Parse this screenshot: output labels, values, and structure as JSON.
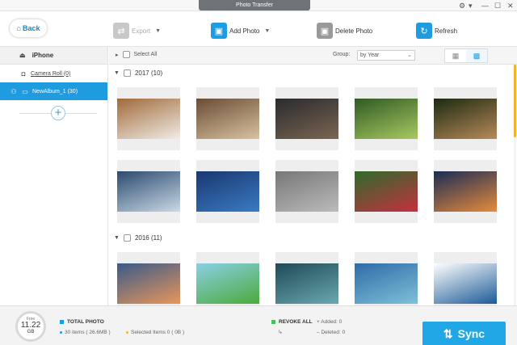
{
  "window": {
    "title": "Photo Transfer"
  },
  "toolbar": {
    "back_label": "Back",
    "export_label": "Export",
    "add_photo_label": "Add Photo",
    "delete_photo_label": "Delete Photo",
    "refresh_label": "Refresh"
  },
  "sidebar": {
    "device": "iPhone",
    "items": [
      {
        "label": "Camera Roll (0)",
        "icon": "camera-icon"
      },
      {
        "label": "NewAlbum_1 (30)",
        "icon": "album-icon",
        "active": true
      }
    ]
  },
  "controls": {
    "select_all": "Select All",
    "group_label": "Group:",
    "group_value": "by Year"
  },
  "sections": [
    {
      "label": "2017 (10)"
    },
    {
      "label": "2016 (11)"
    }
  ],
  "photos_2017": [
    {
      "icon": "kitten-photo",
      "colors": [
        "#a06a3a",
        "#f0ece6"
      ]
    },
    {
      "icon": "piano-room-photo",
      "colors": [
        "#6a4c35",
        "#d8c2a0"
      ]
    },
    {
      "icon": "alley-night-photo",
      "colors": [
        "#2a2a2e",
        "#7a6652"
      ]
    },
    {
      "icon": "tree-road-photo",
      "colors": [
        "#2f5a24",
        "#a8c960"
      ]
    },
    {
      "icon": "squirrel-photo",
      "colors": [
        "#1c2a10",
        "#b78a5a"
      ]
    },
    {
      "icon": "pier-sunset-photo",
      "colors": [
        "#2c4a6e",
        "#c9d9e6"
      ]
    },
    {
      "icon": "city-night-photo",
      "colors": [
        "#1a3870",
        "#3a7ac2"
      ]
    },
    {
      "icon": "cat-walking-photo",
      "colors": [
        "#777777",
        "#bbbbbb"
      ]
    },
    {
      "icon": "flower-leaves-photo",
      "colors": [
        "#2e6b2a",
        "#c43040"
      ]
    },
    {
      "icon": "dusk-horizon-photo",
      "colors": [
        "#1a2c56",
        "#e68a3c"
      ]
    }
  ],
  "photos_2016": [
    {
      "icon": "winter-sunset-photo",
      "colors": [
        "#3a5a8a",
        "#e8965a"
      ]
    },
    {
      "icon": "green-leaf-photo",
      "colors": [
        "#8ad0e6",
        "#4caa3a"
      ]
    },
    {
      "icon": "lake-rocks-photo",
      "colors": [
        "#1e4a56",
        "#6aa8b0"
      ]
    },
    {
      "icon": "mountain-lake-photo",
      "colors": [
        "#2f6ba8",
        "#7fc0d8"
      ]
    },
    {
      "icon": "blue-branches-photo",
      "colors": [
        "#ffffff",
        "#1c5a96"
      ]
    }
  ],
  "status": {
    "free_label": "Free",
    "free_value": "11.22",
    "free_unit": "GB",
    "total_label": "TOTAL PHOTO",
    "items": "30 items ( 26.6MB )",
    "selected": "Selected Items 0 ( 0B )",
    "revoke_label": "REVOKE ALL",
    "added": "Added: 0",
    "deleted": "Deleted: 0",
    "sync_label": "Sync"
  },
  "colors": {
    "accent": "#1f9be0",
    "sync": "#21a7e6",
    "scroll": "#f2b230",
    "revoke": "#4cbd5c"
  }
}
